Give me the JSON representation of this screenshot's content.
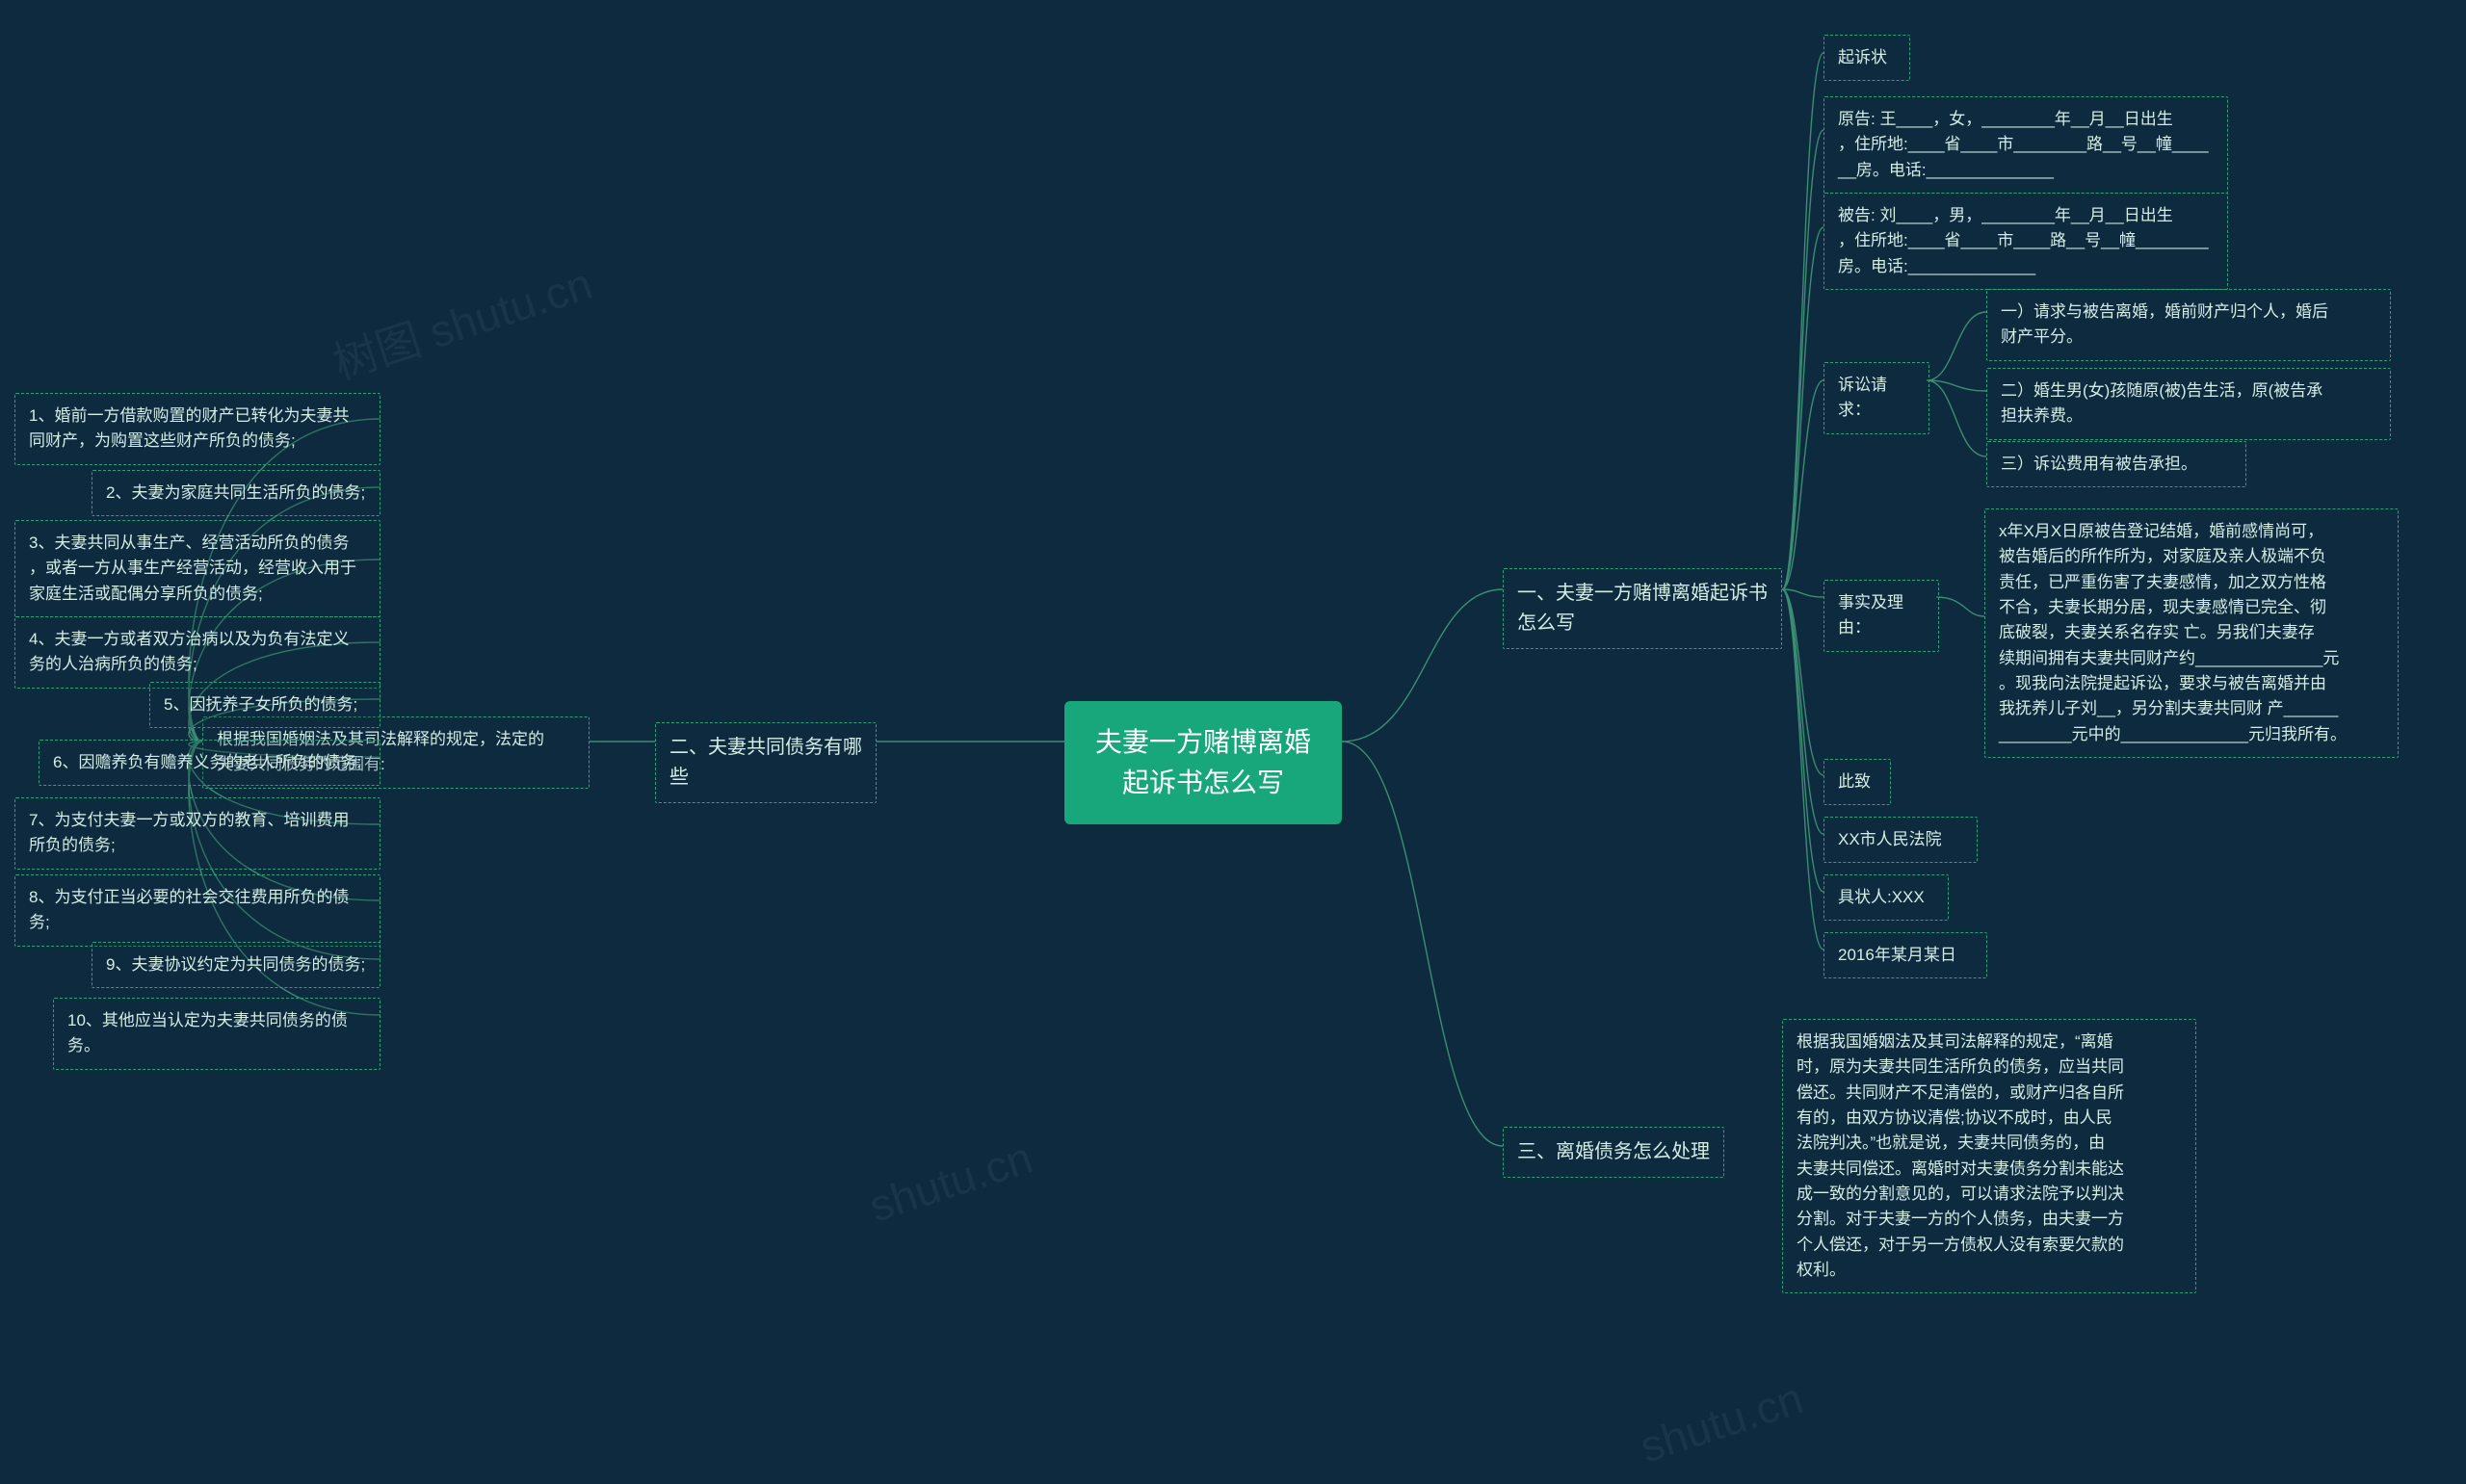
{
  "root": "夫妻一方赌博离婚起诉书怎么写",
  "branch1": {
    "title": "一、夫妻一方赌博离婚起诉书怎么写",
    "items": {
      "qisu": "起诉状",
      "plaintiff": "原告: 王____，女，________年__月__日出生\n，住所地:____省____市________路__号__幢____\n__房。电话:______________",
      "defendant": "被告: 刘____，男，________年__月__日出生\n，住所地:____省____市____路__号__幢________\n房。电话:______________",
      "susong_label": "诉讼请求：",
      "susong_1": "一）请求与被告离婚，婚前财产归个人，婚后\n财产平分。",
      "susong_2": "二）婚生男(女)孩随原(被)告生活，原(被告承\n担扶养费。",
      "susong_3": "三）诉讼费用有被告承担。",
      "shishi_label": "事实及理由：",
      "shishi_body": "x年X月X日原被告登记结婚，婚前感情尚可，\n被告婚后的所作所为，对家庭及亲人极端不负\n责任，已严重伤害了夫妻感情，加之双方性格\n不合，夫妻长期分居，现夫妻感情已完全、彻\n底破裂，夫妻关系名存实 亡。另我们夫妻存\n续期间拥有夫妻共同财产约______________元\n。现我向法院提起诉讼，要求与被告离婚并由\n我抚养儿子刘__，另分割夫妻共同财 产______\n________元中的______________元归我所有。",
      "cizhi": "此致",
      "fayuan": "XX市人民法院",
      "juzhuangren": "具状人:XXX",
      "riqi": "2016年某月某日"
    }
  },
  "branch2": {
    "title": "二、夫妻共同债务有哪些",
    "intro": "根据我国婚姻法及其司法解释的规定，法定的\n夫妻共同债务的范围有:",
    "items": [
      "1、婚前一方借款购置的财产已转化为夫妻共\n同财产，为购置这些财产所负的债务;",
      "2、夫妻为家庭共同生活所负的债务;",
      "3、夫妻共同从事生产、经营活动所负的债务\n，或者一方从事生产经营活动，经营收入用于\n家庭生活或配偶分享所负的债务;",
      "4、夫妻一方或者双方治病以及为负有法定义\n务的人治病所负的债务;",
      "5、因抚养子女所负的债务;",
      "6、因赡养负有赡养义务的老人所负的债务;",
      "7、为支付夫妻一方或双方的教育、培训费用\n所负的债务;",
      "8、为支付正当必要的社会交往费用所负的债\n务;",
      "9、夫妻协议约定为共同债务的债务;",
      "10、其他应当认定为夫妻共同债务的债务。"
    ]
  },
  "branch3": {
    "title": "三、离婚债务怎么处理",
    "body": "根据我国婚姻法及其司法解释的规定，“离婚\n时，原为夫妻共同生活所负的债务，应当共同\n偿还。共同财产不足清偿的，或财产归各自所\n有的，由双方协议清偿;协议不成时，由人民\n法院判决。”也就是说，夫妻共同债务的，由\n夫妻共同偿还。离婚时对夫妻债务分割未能达\n成一致的分割意见的，可以请求法院予以判决\n分割。对于夫妻一方的个人债务，由夫妻一方\n个人偿还，对于另一方债权人没有索要欠款的\n权利。"
  },
  "watermarks": [
    "树图 shutu.cn",
    "shutu.cn",
    "shutu.cn"
  ]
}
